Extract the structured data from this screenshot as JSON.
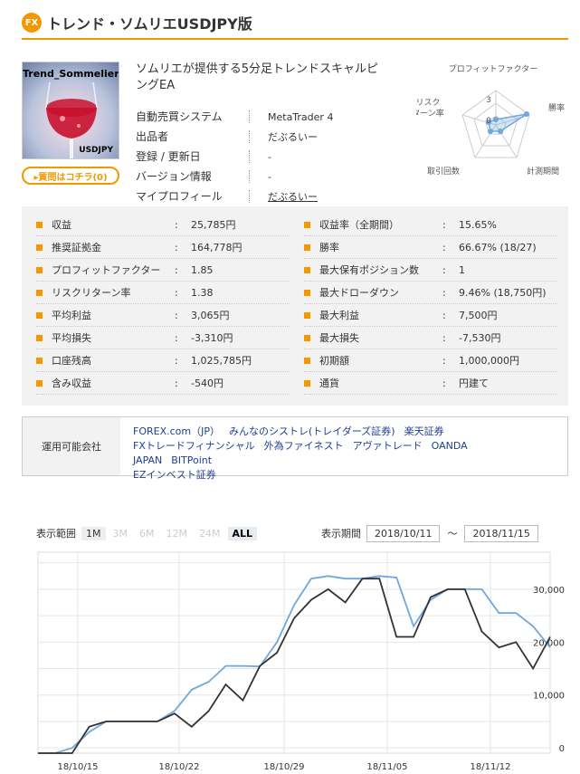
{
  "header": {
    "badge": "FX",
    "title": "トレンド・ソムリエUSDJPY版"
  },
  "product": {
    "thumb_title": "Trend_Sommelier",
    "thumb_sub": "USDJPY",
    "question_button": "▸質問はコチラ(0)",
    "description": "ソムリエが提供する5分足トレンドスキャルピングEA"
  },
  "info": [
    {
      "label": "自動売買システム",
      "value": "MetaTrader 4"
    },
    {
      "label": "出品者",
      "value": "だぶるいー"
    },
    {
      "label": "登録 / 更新日",
      "value": "-"
    },
    {
      "label": "バージョン情報",
      "value": "-"
    },
    {
      "label": "マイプロフィール",
      "value": "だぶるいー"
    }
  ],
  "radar": {
    "labels": [
      "プロフィットファクター",
      "勝率",
      "計測期間",
      "取引回数",
      "リスク\nターン率"
    ],
    "label_top": "プロフィットファクター",
    "label_right": "勝率",
    "label_bottom_right": "計測期間",
    "label_bottom_left": "取引回数",
    "label_left_1": "リスク",
    "label_left_2": "ターン率",
    "tick_3": "3",
    "tick_0": "0"
  },
  "stats_left": [
    {
      "label": "収益",
      "value": "25,785円"
    },
    {
      "label": "推奨証拠金",
      "value": "164,778円"
    },
    {
      "label": "プロフィットファクター",
      "value": "1.85"
    },
    {
      "label": "リスクリターン率",
      "value": "1.38"
    },
    {
      "label": "平均利益",
      "value": "3,065円"
    },
    {
      "label": "平均損失",
      "value": "-3,310円"
    },
    {
      "label": "口座残高",
      "value": "1,025,785円"
    },
    {
      "label": "含み収益",
      "value": "-540円"
    }
  ],
  "stats_right": [
    {
      "label": "収益率（全期間）",
      "value": "15.65%"
    },
    {
      "label": "勝率",
      "value": "66.67% (18/27)"
    },
    {
      "label": "最大保有ポジション数",
      "value": "1"
    },
    {
      "label": "最大ドローダウン",
      "value": "9.46% (18,750円)"
    },
    {
      "label": "最大利益",
      "value": "7,500円"
    },
    {
      "label": "最大損失",
      "value": "-7,530円"
    },
    {
      "label": "初期額",
      "value": "1,000,000円"
    },
    {
      "label": "通貨",
      "value": "円建て"
    }
  ],
  "colon": ":",
  "brokers": {
    "label": "運用可能会社",
    "line1": [
      "FOREX.com（JP）",
      "みんなのシストレ(トレイダーズ証券)",
      "楽天証券"
    ],
    "line2": [
      "FXトレードフィナンシャル",
      "外為ファイネスト",
      "アヴァトレード",
      "OANDA JAPAN",
      "BITPoint"
    ],
    "line3": [
      "EZインベスト証券"
    ]
  },
  "range": {
    "label": "表示範囲",
    "buttons": [
      "1M",
      "3M",
      "6M",
      "12M",
      "24M",
      "ALL"
    ],
    "period_label": "表示期間",
    "from": "2018/10/11",
    "tilde": "～",
    "to": "2018/11/15"
  },
  "chart_data": {
    "type": "line",
    "x_ticks": [
      "18/10/15",
      "18/10/22",
      "18/10/29",
      "18/11/05",
      "18/11/12"
    ],
    "y_ticks": [
      "0",
      "10,000",
      "20,000",
      "30,000"
    ],
    "ylim": [
      -1000,
      37000
    ],
    "grid": true,
    "series": [
      {
        "color": "#6fa8dc",
        "values": [
          -1000,
          -1000,
          0,
          3000,
          5000,
          5000,
          5000,
          5000,
          7000,
          11000,
          12500,
          15500,
          15500,
          15400,
          20000,
          27000,
          32000,
          32500,
          32000,
          32000,
          32500,
          32200,
          23000,
          28000,
          30000,
          30000,
          30000,
          25500,
          25500,
          23000,
          19000
        ]
      },
      {
        "color": "#333333",
        "values": [
          -1000,
          -1000,
          -1000,
          4000,
          5000,
          5000,
          5000,
          5000,
          6500,
          4000,
          7000,
          12000,
          9000,
          15500,
          18000,
          24500,
          28000,
          30000,
          27500,
          32000,
          32000,
          21000,
          21000,
          28500,
          30000,
          30000,
          22000,
          19000,
          20000,
          15000,
          21000
        ]
      }
    ]
  },
  "colors": {
    "accent": "#f39800",
    "panel_bg": "#f2f2f2",
    "link": "#1f3f8f"
  }
}
